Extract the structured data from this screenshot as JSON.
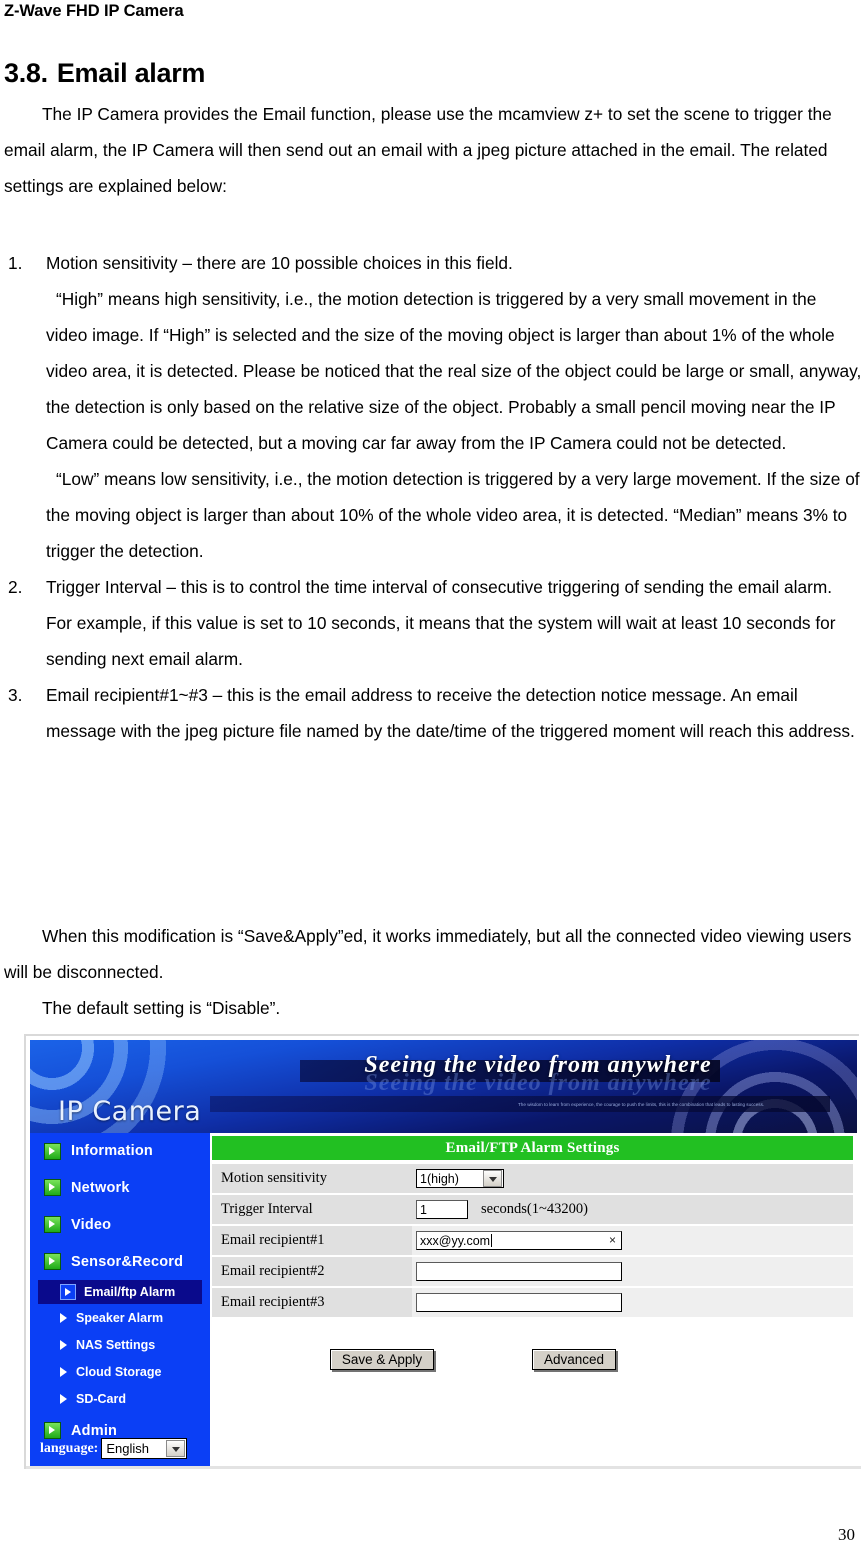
{
  "document": {
    "running_header": "Z-Wave FHD IP Camera",
    "page_number": "30",
    "section_number": "3.8.",
    "section_title": "Email alarm",
    "intro": "The IP Camera provides the Email function, please use the mcamview z+ to set the scene to trigger the email alarm, the IP Camera will then send out an email with a jpeg picture attached in the email. The related settings are explained below:",
    "list": [
      {
        "num": "1.",
        "lead": "Motion sensitivity – there are 10 possible choices in this field.",
        "paras": [
          "“High” means high sensitivity, i.e., the motion detection is triggered by a very small movement in the video image. If “High” is selected and the size of the moving object is larger than about 1% of the whole video area, it is detected. Please be noticed that the real size of the object could be large or small, anyway, the detection is only based on the relative size of the object. Probably a small pencil moving near the IP Camera could be detected, but a moving car far away from the IP Camera could not be detected.",
          "“Low” means low sensitivity, i.e., the motion detection is triggered by a very large movement. If the size of the moving object is larger than about 10% of the whole video area, it is detected. “Median” means 3% to trigger the detection."
        ]
      },
      {
        "num": "2.",
        "lead": "Trigger Interval – this is to control the time interval of consecutive triggering of sending the email alarm. For example, if this value is set to 10 seconds, it means that the system will wait at least 10 seconds for sending next email alarm.",
        "paras": []
      },
      {
        "num": "3.",
        "lead": "Email recipient#1~#3 – this is the email address to receive the detection notice message. An email message with the jpeg picture file named by the date/time of the triggered moment will reach this address.",
        "paras": []
      }
    ],
    "closing": "When this modification is “Save&Apply”ed, it works immediately, but all the connected video viewing users will be disconnected.",
    "default_note": "The default setting is “Disable”."
  },
  "screenshot": {
    "banner": {
      "product_title": "IP Camera",
      "slogan": "Seeing the video from anywhere",
      "fineprint": "The wisdom to learn from experience,\nthe courage to push the limits,\nthis is the combination that leads to lasting success."
    },
    "sidebar": {
      "items": [
        {
          "label": "Information",
          "icon": "green-arrow-icon"
        },
        {
          "label": "Network",
          "icon": "green-arrow-icon"
        },
        {
          "label": "Video",
          "icon": "green-arrow-icon"
        },
        {
          "label": "Sensor&Record",
          "icon": "green-arrow-icon"
        }
      ],
      "sub_items": [
        {
          "label": "Email/ftp Alarm",
          "active": true,
          "icon": "boxed-arrow-icon"
        },
        {
          "label": "Speaker Alarm",
          "active": false,
          "icon": "triangle-icon"
        },
        {
          "label": "NAS Settings",
          "active": false,
          "icon": "triangle-icon"
        },
        {
          "label": "Cloud Storage",
          "active": false,
          "icon": "triangle-icon"
        },
        {
          "label": "SD-Card",
          "active": false,
          "icon": "triangle-icon"
        }
      ],
      "admin": {
        "label": "Admin",
        "icon": "green-arrow-icon"
      },
      "language": {
        "label": "language:",
        "value": "English",
        "options": [
          "English"
        ]
      }
    },
    "panel": {
      "title": "Email/FTP Alarm Settings",
      "rows": [
        {
          "label": "Motion sensitivity",
          "control": "select",
          "value": "1(high)",
          "options": [
            "1(high)"
          ]
        },
        {
          "label": "Trigger Interval",
          "control": "text",
          "value": "1",
          "unit": "seconds(1~43200)"
        },
        {
          "label": "Email recipient#1",
          "control": "text-clearable",
          "value": "xxx@yy.com",
          "clear_glyph": "×"
        },
        {
          "label": "Email recipient#2",
          "control": "text",
          "value": ""
        },
        {
          "label": "Email recipient#3",
          "control": "text",
          "value": ""
        }
      ],
      "buttons": {
        "save": "Save & Apply",
        "advanced": "Advanced"
      }
    },
    "colors": {
      "sidebar_blue": "#0b3ff5",
      "active_item_navy": "#0a0a8c",
      "panel_title_green": "#22c022",
      "row_gray": "#e0e0e0",
      "button_face": "#d4d0c8"
    }
  }
}
